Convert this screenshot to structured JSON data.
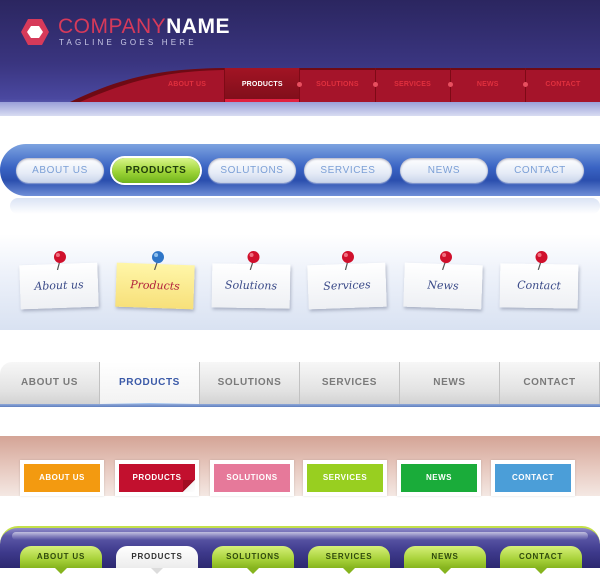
{
  "header": {
    "company_first": "COMPANY",
    "company_second": "NAME",
    "tagline": "TAGLINE GOES HERE",
    "logo_icon": "hexagon-logo-icon",
    "nav": [
      "ABOUT US",
      "PRODUCTS",
      "SOLUTIONS",
      "SERVICES",
      "NEWS",
      "CONTACT"
    ],
    "active": "PRODUCTS",
    "colors": {
      "accent": "#d63a5a",
      "nav_red": "#a21424",
      "background": "#2b2660"
    }
  },
  "pill_nav": {
    "items": [
      "ABOUT US",
      "PRODUCTS",
      "SOLUTIONS",
      "SERVICES",
      "NEWS",
      "CONTACT"
    ],
    "active": "PRODUCTS",
    "colors": {
      "tube": "#3a64c4",
      "active": "#9ed438"
    }
  },
  "sticky_nav": {
    "items": [
      "About us",
      "Products",
      "Solutions",
      "Services",
      "News",
      "Contact"
    ],
    "active": "Products",
    "pin_icon": "push-pin-icon",
    "colors": {
      "pin_red": "#d0102c",
      "pin_blue": "#2f76c8",
      "active_note": "#f7e07a"
    }
  },
  "tab_nav": {
    "items": [
      "ABOUT US",
      "PRODUCTS",
      "SOLUTIONS",
      "SERVICES",
      "NEWS",
      "CONTACT"
    ],
    "active": "PRODUCTS",
    "colors": {
      "active_text": "#3b5aa8",
      "text": "#7a7a7a"
    }
  },
  "color_nav": {
    "items": [
      {
        "label": "ABOUT US",
        "color": "#f39a10"
      },
      {
        "label": "PRODUCTS",
        "color": "#c2102e"
      },
      {
        "label": "SOLUTIONS",
        "color": "#e6799a"
      },
      {
        "label": "SERVICES",
        "color": "#98cf20"
      },
      {
        "label": "NEWS",
        "color": "#1aac3a"
      },
      {
        "label": "CONTACT",
        "color": "#4b9ed8"
      }
    ],
    "active": "PRODUCTS"
  },
  "green_nav": {
    "items": [
      "ABOUT US",
      "PRODUCTS",
      "SOLUTIONS",
      "SERVICES",
      "NEWS",
      "CONTACT"
    ],
    "active": "PRODUCTS",
    "colors": {
      "bar": "#3e3a8c",
      "tab": "#a8d23a"
    }
  }
}
